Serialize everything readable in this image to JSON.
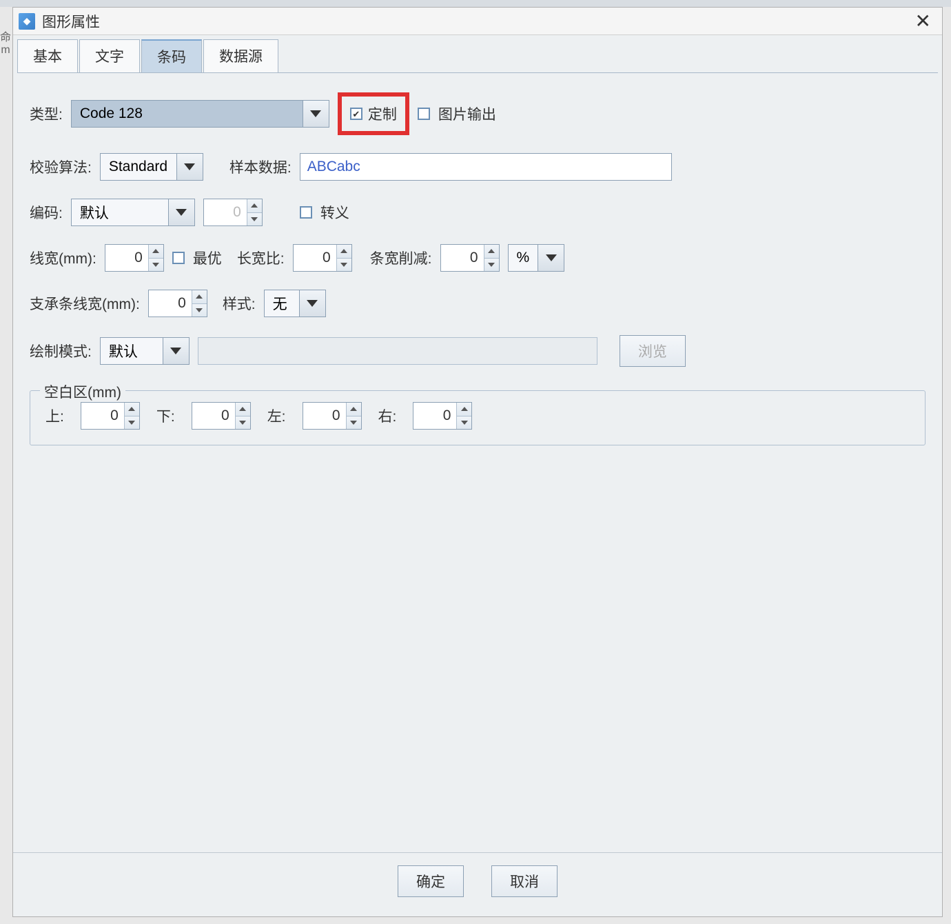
{
  "window": {
    "title": "图形属性",
    "close_glyph": "✕"
  },
  "side_fragment": "命\nm",
  "tabs": {
    "basic": "基本",
    "text": "文字",
    "barcode": "条码",
    "datasource": "数据源"
  },
  "labels": {
    "type": "类型:",
    "custom": "定制",
    "image_output": "图片输出",
    "algorithm": "校验算法:",
    "sample_data": "样本数据:",
    "encoding": "编码:",
    "escape": "转义",
    "line_width": "线宽(mm):",
    "optimal": "最优",
    "aspect_ratio": "长宽比:",
    "bar_reduction": "条宽削减:",
    "bearer_width": "支承条线宽(mm):",
    "style": "样式:",
    "render_mode": "绘制模式:",
    "browse": "浏览",
    "blank_area": "空白区(mm)",
    "top": "上:",
    "bottom": "下:",
    "left": "左:",
    "right": "右:",
    "ok": "确定",
    "cancel": "取消"
  },
  "values": {
    "type": "Code 128",
    "algorithm": "Standard",
    "sample_data": "ABCabc",
    "encoding": "默认",
    "encoding_num": "0",
    "line_width": "0",
    "aspect_ratio": "0",
    "bar_reduction": "0",
    "bar_reduction_unit": "%",
    "bearer_width": "0",
    "style": "无",
    "render_mode": "默认",
    "margin_top": "0",
    "margin_bottom": "0",
    "margin_left": "0",
    "margin_right": "0",
    "custom_checked": "✔"
  }
}
